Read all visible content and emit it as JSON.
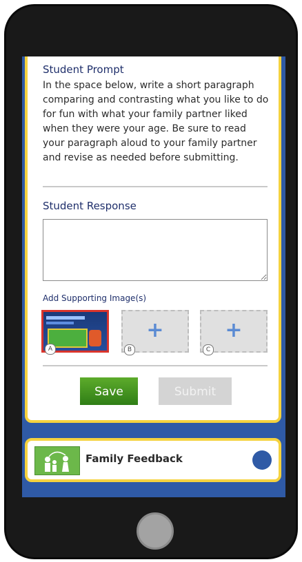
{
  "prompt": {
    "title": "Student Prompt",
    "text": "In the space below, write a short paragraph comparing and contrasting what you like to do for fun with what your family partner liked when they were your age. Be sure to read your paragraph aloud to your family partner and revise as needed before submitting."
  },
  "response": {
    "label": "Student Response",
    "value": ""
  },
  "images": {
    "label": "Add Supporting Image(s)",
    "slots": [
      {
        "letter": "A",
        "state": "selected"
      },
      {
        "letter": "B",
        "state": "empty",
        "plus": "+"
      },
      {
        "letter": "C",
        "state": "empty",
        "plus": "+"
      }
    ]
  },
  "buttons": {
    "save": "Save",
    "submit": "Submit"
  },
  "feedback": {
    "label": "Family Feedback",
    "icon": "family-icon",
    "indicator_color": "#2f5aa6"
  },
  "colors": {
    "accent_blue": "#2f5aa6",
    "card_border": "#f5d23f",
    "save_green": "#4a9a22",
    "selected_red": "#d9342c"
  }
}
